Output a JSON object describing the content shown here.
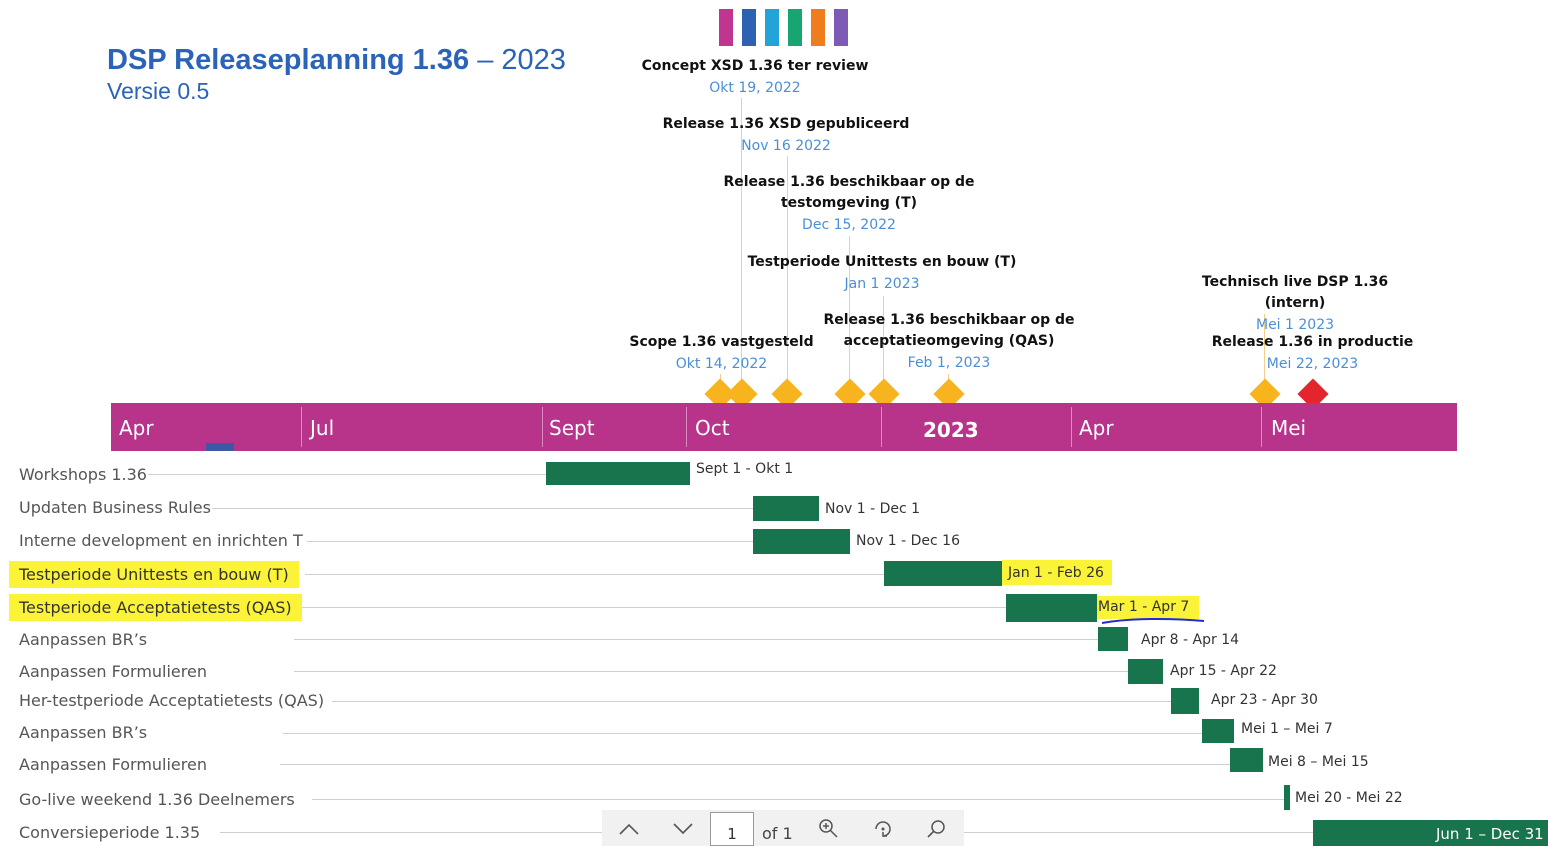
{
  "title": {
    "main": "DSP Releaseplanning 1.36",
    "suffix": "– 2023",
    "version": "Versie 0.5"
  },
  "swatch_colors": [
    "#c0358f",
    "#2d62b3",
    "#22a4d9",
    "#17a572",
    "#ef7d1e",
    "#7d5bb5"
  ],
  "milestones": [
    {
      "label": "Concept XSD 1.36 ter review",
      "date": "Okt 19, 2022"
    },
    {
      "label": "Release 1.36 XSD gepubliceerd",
      "date": "Nov 16 2022"
    },
    {
      "label": "Release 1.36 beschikbaar op de\ntestomgeving (T)",
      "date": "Dec 15, 2022"
    },
    {
      "label": "Testperiode Unittests en bouw (T)",
      "date": "Jan 1 2023"
    },
    {
      "label": "Release 1.36 beschikbaar op de\nacceptatieomgeving (QAS)",
      "date": "Feb 1, 2023"
    },
    {
      "label": "Scope 1.36 vastgesteld",
      "date": "Okt 14, 2022"
    },
    {
      "label": "Technisch live DSP 1.36 (intern)",
      "date": "Mei 1 2023"
    },
    {
      "label": "Release 1.36 in productie",
      "date": "Mei 22, 2023"
    }
  ],
  "timeline": {
    "color": "#b8338a",
    "ticks": [
      "Apr",
      "Jul",
      "Sept",
      "Oct",
      "2023",
      "Apr",
      "Mei"
    ]
  },
  "tasks": [
    {
      "name": "Workshops 1.36",
      "range": "Sept 1 - Okt 1",
      "highlight": false
    },
    {
      "name": "Updaten Business Rules",
      "range": "Nov 1 - Dec 1",
      "highlight": false
    },
    {
      "name": "Interne development en inrichten T",
      "range": "Nov 1 - Dec 16",
      "highlight": false
    },
    {
      "name": "Testperiode Unittests en bouw (T)",
      "range": "Jan 1 - Feb 26",
      "highlight": true
    },
    {
      "name": "Testperiode Acceptatietests (QAS)",
      "range": "Mar 1 - Apr 7",
      "highlight": true
    },
    {
      "name": "Aanpassen BR’s",
      "range": "Apr 8 - Apr 14",
      "highlight": false
    },
    {
      "name": "Aanpassen Formulieren",
      "range": "Apr 15 - Apr 22",
      "highlight": false
    },
    {
      "name": "Her-testperiode Acceptatietests (QAS)",
      "range": "Apr 23 - Apr 30",
      "highlight": false
    },
    {
      "name": "Aanpassen BR’s",
      "range": "Mei 1 – Mei 7",
      "highlight": false
    },
    {
      "name": "Aanpassen Formulieren",
      "range": "Mei 8 – Mei 15",
      "highlight": false
    },
    {
      "name": "Go-live weekend 1.36 Deelnemers",
      "range": "Mei 20 - Mei 22",
      "highlight": false
    },
    {
      "name": "Conversieperiode 1.35",
      "range": "Jun 1 – Dec 31",
      "highlight": false
    }
  ],
  "colors": {
    "bar": "#17744c",
    "diamond": "#f7b41f",
    "diamond_final": "#e3262d",
    "highlight": "#fbf337"
  },
  "pdf_toolbar": {
    "page": "1",
    "of_pages": "of 1"
  }
}
